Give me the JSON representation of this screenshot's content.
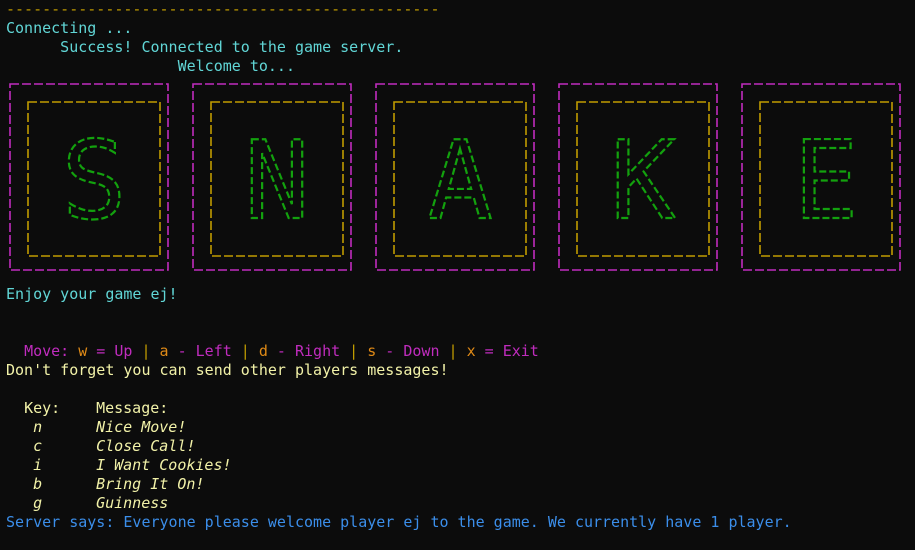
{
  "header": {
    "rule": "------------------------------------------------",
    "connecting": "Connecting ...",
    "success": "      Success! Connected to the game server.",
    "welcome": "                   Welcome to..."
  },
  "banner": {
    "letters": [
      "S",
      "N",
      "A",
      "K",
      "E"
    ]
  },
  "greeting": "Enjoy your game ej!",
  "controls": {
    "label": "Move: ",
    "items": [
      {
        "key": "w",
        "text": " = Up"
      },
      {
        "key": "a",
        "text": " - Left"
      },
      {
        "key": "d",
        "text": " - Right"
      },
      {
        "key": "s",
        "text": " - Down"
      },
      {
        "key": "x",
        "text": " = Exit"
      }
    ],
    "separator": " | "
  },
  "messages": {
    "intro": "Don't forget you can send other players messages!",
    "key_header": "Key:",
    "message_header": "Message:",
    "rows": [
      {
        "key": "n",
        "message": "Nice Move!"
      },
      {
        "key": "c",
        "message": "Close Call!"
      },
      {
        "key": "i",
        "message": "I Want Cookies!"
      },
      {
        "key": "b",
        "message": "Bring It On!"
      },
      {
        "key": "g",
        "message": "Guinness"
      }
    ]
  },
  "server": "Server says: Everyone please welcome player ej to the game. We currently have 1 player.",
  "colors": {
    "background": "#0c0c0c",
    "teal": "#61d6d6",
    "orange": "#c19c00",
    "magenta": "#c02cbe",
    "green": "#13a10e",
    "cream": "#f2f2a8",
    "blue": "#3b8eea"
  }
}
